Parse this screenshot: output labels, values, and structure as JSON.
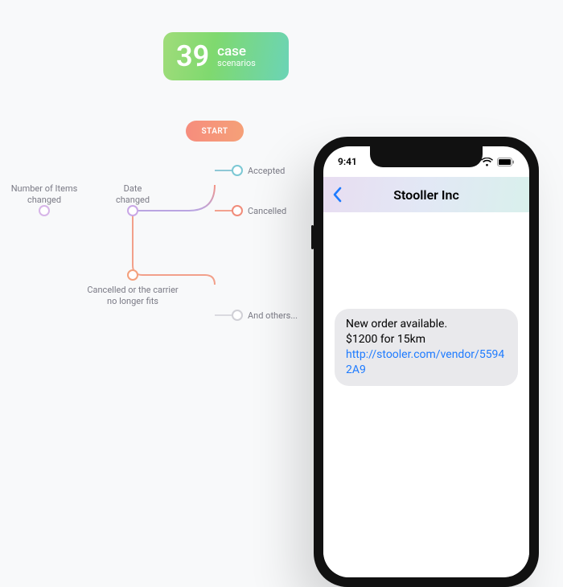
{
  "badge": {
    "count": "39",
    "line1": "case",
    "line2": "scenarios"
  },
  "diagram": {
    "start": "START",
    "nodes": {
      "accepted": "Accepted",
      "cancelled": "Cancelled",
      "others": "And others...",
      "date": "Date\nchanged",
      "items": "Number of Items\nchanged",
      "nolonger": "Cancelled or the carrier\nno longer fits"
    }
  },
  "phone": {
    "time": "9:41",
    "title": "Stooller Inc",
    "message": {
      "line1": "New order available.",
      "line2": "$1200 for 15km",
      "link": "http://stooler.com/vendor/55942A9"
    }
  },
  "colors": {
    "accepted": "#7cc8d4",
    "cancelled": "#f08c7a",
    "others": "#d0d0d6",
    "date": "#c9a7e6",
    "items": "#d7b5e8",
    "nolonger": "#f4a07c"
  }
}
